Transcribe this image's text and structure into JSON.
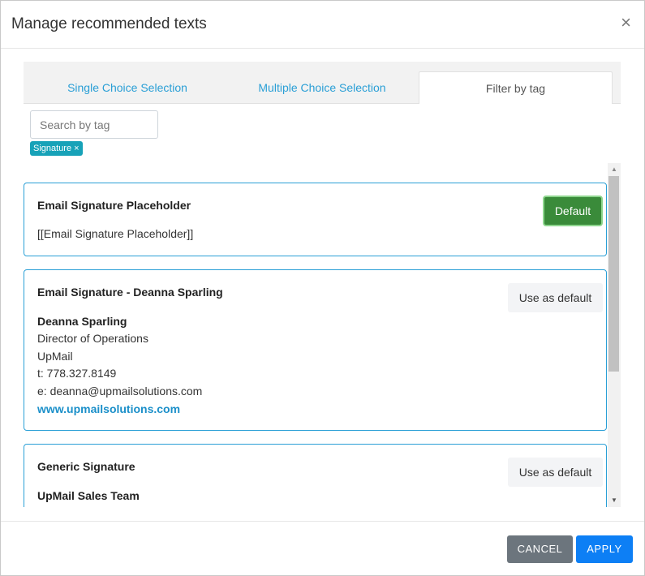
{
  "modal": {
    "title": "Manage recommended texts",
    "close_glyph": "×"
  },
  "tabs": [
    {
      "label": "Single Choice Selection",
      "active": false
    },
    {
      "label": "Multiple Choice Selection",
      "active": false
    },
    {
      "label": "Filter by tag",
      "active": true
    }
  ],
  "search": {
    "placeholder": "Search by tag",
    "value": ""
  },
  "tags": [
    {
      "label": "Signature",
      "remove_glyph": "×"
    }
  ],
  "cards": [
    {
      "title": "Email Signature Placeholder",
      "body": "[[Email Signature Placeholder]]",
      "button": "Default",
      "is_default": true
    },
    {
      "title": "Email Signature - Deanna Sparling",
      "button": "Use as default",
      "is_default": false,
      "signature": {
        "name": "Deanna Sparling",
        "role": "Director of Operations",
        "company": "UpMail",
        "phone": "t: 778.327.8149",
        "email": "e: deanna@upmailsolutions.com",
        "website": "www.upmailsolutions.com"
      }
    },
    {
      "title": "Generic Signature",
      "button": "Use as default",
      "is_default": false,
      "signature": {
        "name": "UpMail Sales Team"
      }
    }
  ],
  "scrollbar": {
    "up_glyph": "▲",
    "down_glyph": "▼"
  },
  "footer": {
    "cancel_label": "CANCEL",
    "apply_label": "APPLY"
  },
  "colors": {
    "accent": "#2a9fd6",
    "default_green": "#3a8b3a",
    "apply_blue": "#0d7ff5",
    "cancel_gray": "#6c757d",
    "tag_teal": "#17a2b8"
  }
}
